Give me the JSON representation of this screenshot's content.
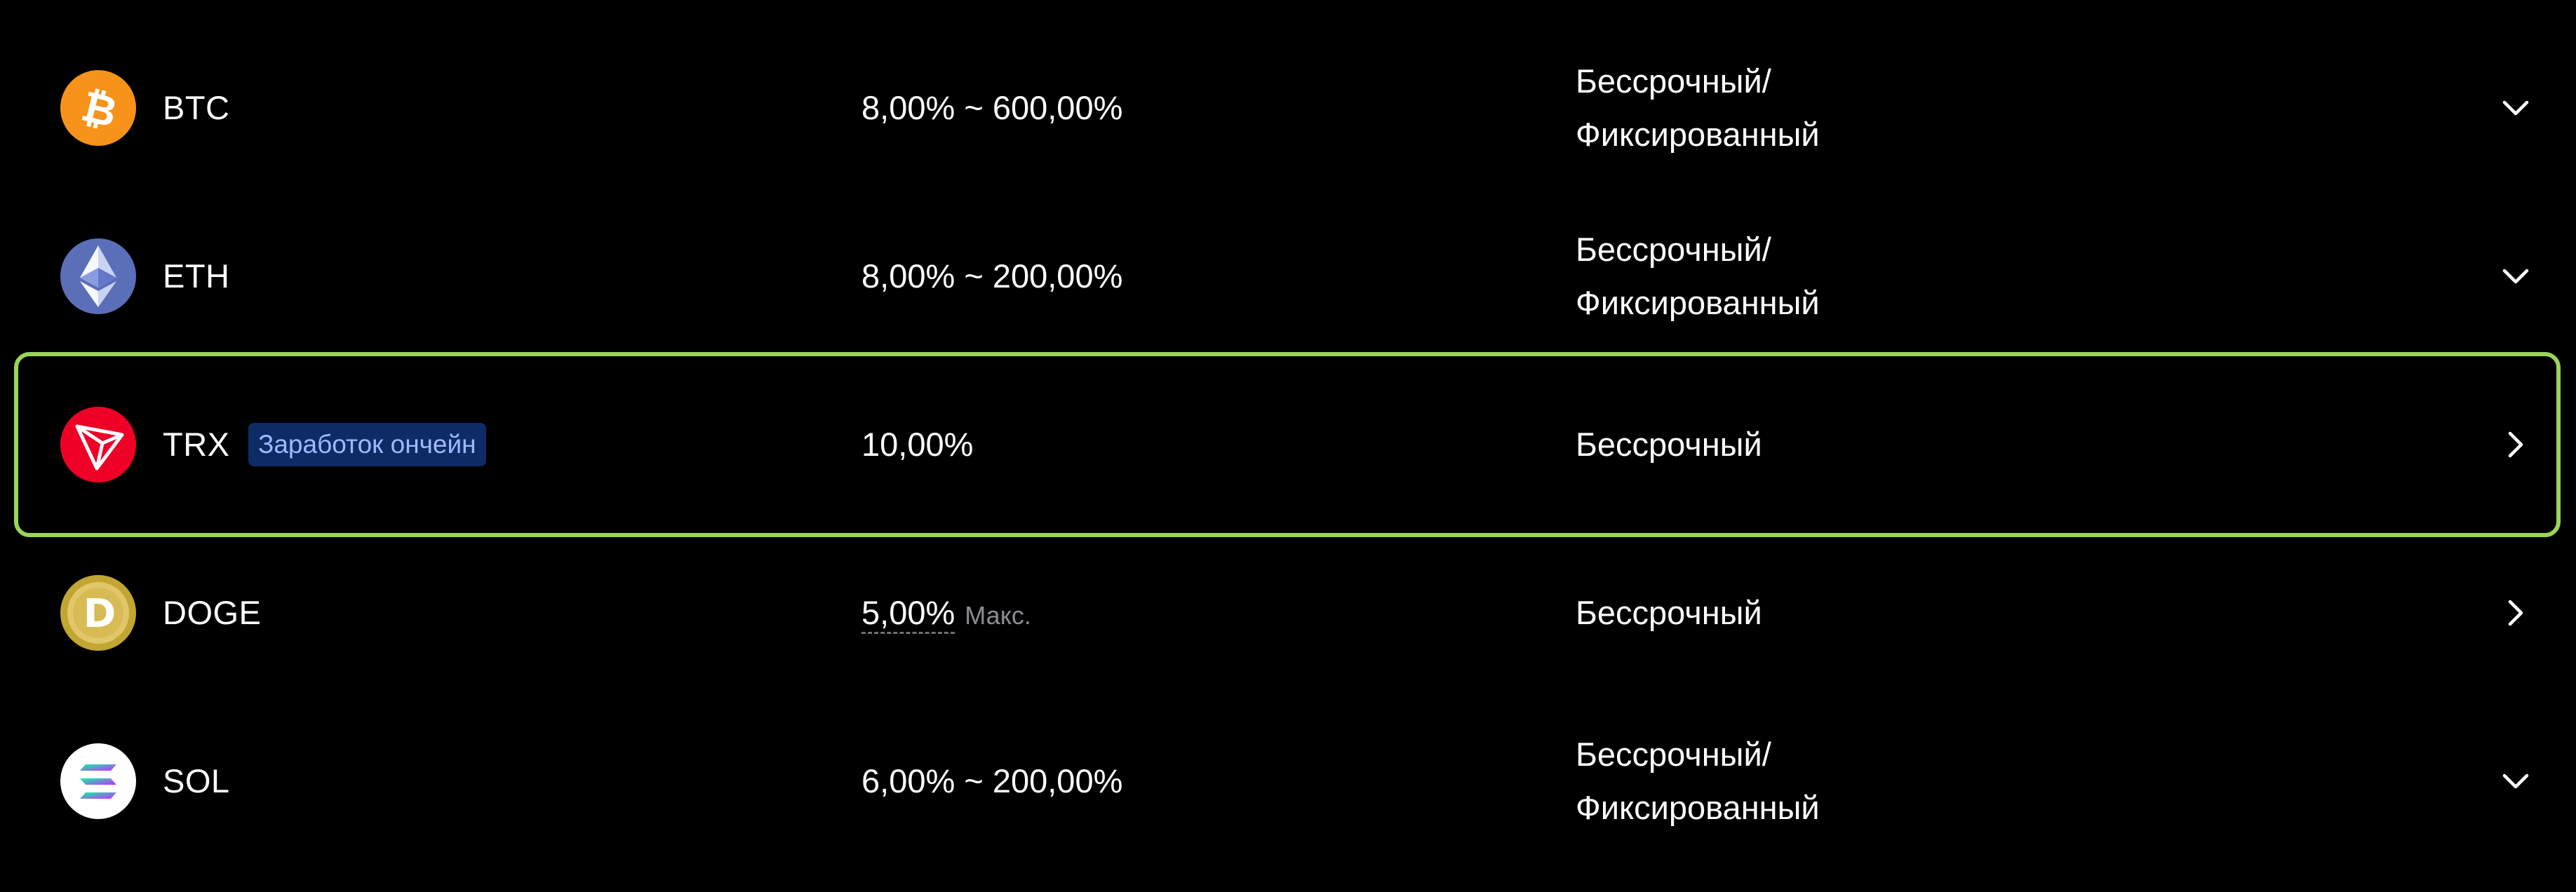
{
  "earn_list": {
    "items": [
      {
        "symbol": "BTC",
        "icon": "bitcoin-icon",
        "icon_color": "#f7931a",
        "apr": "8,00% ~ 600,00%",
        "term_line1": "Бессрочный/",
        "term_line2": "Фиксированный",
        "action_icon": "chevron-down-icon"
      },
      {
        "symbol": "ETH",
        "icon": "ethereum-icon",
        "icon_color": "#627eea",
        "apr": "8,00% ~ 200,00%",
        "term_line1": "Бессрочный/",
        "term_line2": "Фиксированный",
        "action_icon": "chevron-down-icon"
      },
      {
        "symbol": "TRX",
        "icon": "tron-icon",
        "icon_color": "#ef0027",
        "tag": "Заработок ончейн",
        "apr": "10,00%",
        "term_line1": "Бессрочный",
        "action_icon": "chevron-right-icon",
        "selected": true
      },
      {
        "symbol": "DOGE",
        "icon": "dogecoin-icon",
        "icon_color": "#c2a633",
        "apr": "5,00%",
        "apr_note": "Макс.",
        "term_line1": "Бессрочный",
        "action_icon": "chevron-right-icon"
      },
      {
        "symbol": "SOL",
        "icon": "solana-icon",
        "icon_color": "#ffffff",
        "apr": "6,00% ~ 200,00%",
        "term_line1": "Бессрочный/",
        "term_line2": "Фиксированный",
        "action_icon": "chevron-down-icon"
      }
    ]
  },
  "colors": {
    "background": "#000000",
    "selected_border": "#9bd35b",
    "tag_background": "#0f2b66",
    "tag_text": "#9fb8ff",
    "muted_text": "#8c8c94"
  }
}
